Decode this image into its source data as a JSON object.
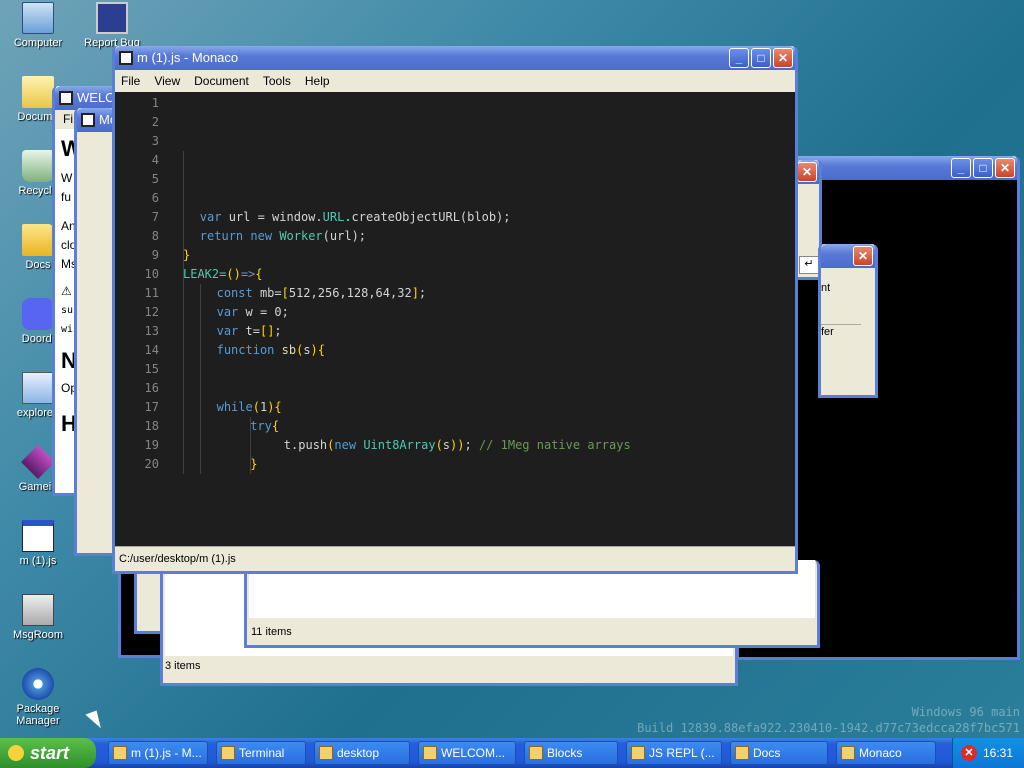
{
  "desktop": {
    "icons": [
      {
        "label": "Computer",
        "icon": "computer-icon"
      },
      {
        "label": "Report Bug",
        "icon": "report-bug-icon"
      },
      {
        "label": "Docume",
        "icon": "documents-icon"
      },
      {
        "label": "Recycle",
        "icon": "recycle-bin-icon"
      },
      {
        "label": "Docs",
        "icon": "folder-icon"
      },
      {
        "label": "Doordi",
        "icon": "discord-icon"
      },
      {
        "label": "explorer.",
        "icon": "explorer-icon"
      },
      {
        "label": "Gamein",
        "icon": "game-icon"
      },
      {
        "label": "m (1).js",
        "icon": "js-file-icon"
      },
      {
        "label": "MsgRoom",
        "icon": "msgroom-icon"
      },
      {
        "label": "Package Manager",
        "icon": "package-manager-icon"
      }
    ],
    "watermark": [
      "Windows 96 main",
      "Build 12839.88efa922.230410-1942.d77c73edcca28f7bc571"
    ]
  },
  "background_windows": {
    "welcome_title": "WELCO",
    "welcome_menu": "Fi",
    "welcome_heading": "W",
    "welcome_lines": [
      "W",
      "fu",
      "An",
      "clo",
      "Ms",
      "⚠",
      "su",
      "wi"
    ],
    "welcome_heading2": "N",
    "welcome_line2": "Op",
    "welcome_heading3": "H",
    "small_title": "Mo",
    "dialog_text1": "nt",
    "dialog_text2": "fer",
    "folder1_status": "11 items",
    "folder2_status": "3 items"
  },
  "monaco": {
    "title": "m (1).js - Monaco",
    "menu": [
      "File",
      "View",
      "Document",
      "Tools",
      "Help"
    ],
    "statusbar": "C:/user/desktop/m (1).js",
    "line_numbers": [
      "1",
      "2",
      "3",
      "4",
      "5",
      "6",
      "7",
      "8",
      "9",
      "10",
      "11",
      "12",
      "13",
      "14",
      "15",
      "16",
      "17",
      "18",
      "19",
      "20"
    ],
    "code": {
      "l7": [
        "var",
        " url = window.",
        "URL",
        ".createObjectURL(blob);"
      ],
      "l8": [
        "return",
        " ",
        "new",
        " ",
        "Worker",
        "(url);"
      ],
      "l9": "}",
      "l10": [
        "LEAK2=",
        "()",
        "=>",
        "{"
      ],
      "l11": [
        "const",
        " mb=",
        "[",
        "512,256,128,64,32",
        "]",
        ";"
      ],
      "l12": [
        "var",
        " w = 0;"
      ],
      "l13": [
        "var",
        " t=",
        "[]",
        ";"
      ],
      "l14": [
        "function",
        " sb",
        "(",
        "s",
        ")",
        "{"
      ],
      "l17": [
        "while",
        "(",
        "1",
        ")",
        "{"
      ],
      "l18": [
        "try",
        "{"
      ],
      "l19": [
        "t.push",
        "(",
        "new",
        " ",
        "Uint8Array",
        "(",
        "s",
        ")",
        ")",
        "; ",
        "// 1Meg native arrays"
      ],
      "l20": "}"
    }
  },
  "taskbar": {
    "start": "start",
    "tasks": [
      "m (1).js - M...",
      "Terminal",
      "desktop",
      "WELCOM...",
      "Blocks",
      "JS REPL (...",
      "Docs",
      "Monaco"
    ],
    "clock": "16:31"
  },
  "colors": {
    "editor_bg": "#1e1e1e",
    "keyword": "#569cd6",
    "type": "#4ec9b0",
    "comment": "#6a9955",
    "bracket": "#ffd700"
  }
}
